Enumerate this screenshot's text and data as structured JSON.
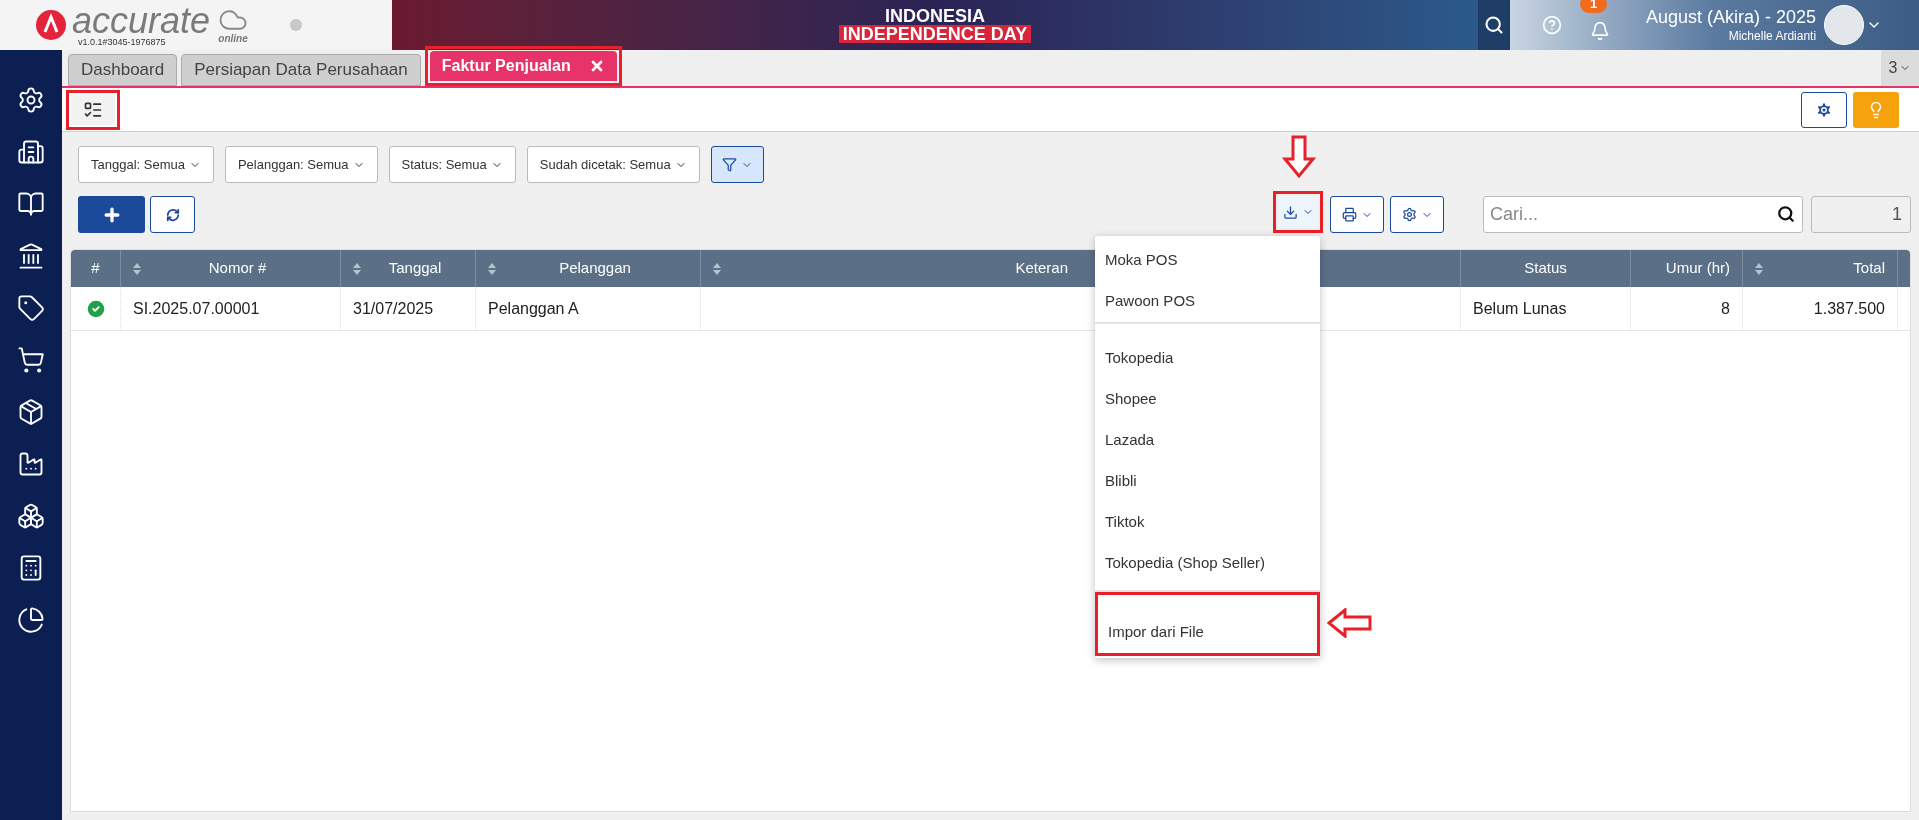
{
  "header": {
    "logo": {
      "brand": "accurate",
      "suffix": "online",
      "version": "v1.0.1#3045-1976875"
    },
    "banner": {
      "lines": [
        "INDONESIA",
        "INDEPENDENCE DAY"
      ]
    },
    "notifications": {
      "count": "1"
    },
    "user": {
      "period": "August (Akira) - 2025",
      "name": "Michelle Ardianti"
    }
  },
  "tabs": [
    {
      "label": "Dashboard",
      "selected": false,
      "closable": false,
      "annotated": false
    },
    {
      "label": "Persiapan Data Perusahaan",
      "selected": false,
      "closable": false,
      "annotated": false
    },
    {
      "label": "Faktur Penjualan",
      "selected": true,
      "closable": true,
      "annotated": true
    }
  ],
  "tab_overflow": {
    "count": "3"
  },
  "view_toggle": {
    "annotated": true
  },
  "filters": [
    {
      "label": "Tanggal: Semua"
    },
    {
      "label": "Pelanggan: Semua"
    },
    {
      "label": "Status: Semua"
    },
    {
      "label": "Sudah dicetak: Semua"
    }
  ],
  "import_button": {
    "annotated": true,
    "expanded": true
  },
  "search": {
    "placeholder": "Cari..."
  },
  "page": {
    "value": "1"
  },
  "table": {
    "columns": [
      {
        "label": "#",
        "sortable": false
      },
      {
        "label": "Nomor #",
        "sortable": true
      },
      {
        "label": "Tanggal",
        "sortable": true
      },
      {
        "label": "Pelanggan",
        "sortable": true
      },
      {
        "label": "Keteran",
        "sortable": true
      },
      {
        "label": "Status",
        "sortable": false
      },
      {
        "label": "Umur (hr)",
        "sortable": false
      },
      {
        "label": "Total",
        "sortable": true
      }
    ],
    "rows": [
      {
        "ok": true,
        "cells": [
          "",
          "SI.2025.07.00001",
          "31/07/2025",
          "Pelanggan A",
          "",
          "Belum Lunas",
          "8",
          "1.387.500"
        ]
      }
    ]
  },
  "import_menu": {
    "groups": [
      {
        "items": [
          {
            "label": "Moka POS",
            "annotated": false
          },
          {
            "label": "Pawoon POS",
            "annotated": false
          }
        ]
      },
      {
        "items": [
          {
            "label": "Tokopedia",
            "annotated": false
          },
          {
            "label": "Shopee",
            "annotated": false
          },
          {
            "label": "Lazada",
            "annotated": false
          },
          {
            "label": "Blibli",
            "annotated": false
          },
          {
            "label": "Tiktok",
            "annotated": false
          },
          {
            "label": "Tokopedia (Shop Seller)",
            "annotated": false
          }
        ]
      },
      {
        "items": [
          {
            "label": "Impor dari File",
            "annotated": true
          }
        ]
      }
    ]
  }
}
